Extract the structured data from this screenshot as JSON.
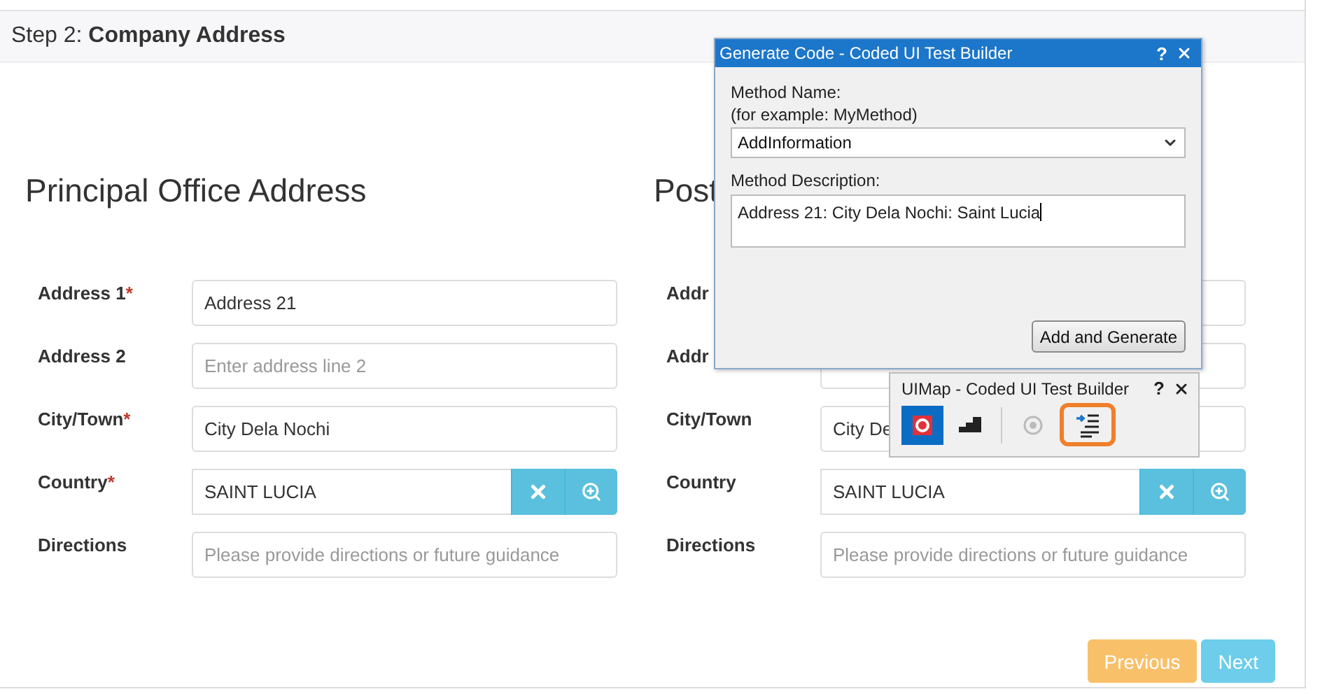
{
  "header": {
    "step": "Step 2:",
    "title": "Company Address"
  },
  "sections": [
    {
      "heading": "Principal Office Address",
      "fields": [
        {
          "label": "Address 1",
          "required_mark": "*",
          "value": "Address 21"
        },
        {
          "label": "Address 2",
          "placeholder": "Enter address line 2"
        },
        {
          "label": "City/Town",
          "required_mark": "*",
          "value": "City Dela Nochi"
        },
        {
          "label": "Country",
          "required_mark": "*",
          "value": "SAINT LUCIA",
          "kind": "lookup"
        },
        {
          "label": "Directions",
          "placeholder": "Please provide directions or future guidance"
        }
      ]
    },
    {
      "heading": "Post",
      "fields": [
        {
          "label": "Addr"
        },
        {
          "label": "Addr"
        },
        {
          "label": "City/Town",
          "value": "City De"
        },
        {
          "label": "Country",
          "value": "SAINT LUCIA",
          "kind": "lookup"
        },
        {
          "label": "Directions",
          "placeholder": "Please provide directions or future guidance"
        }
      ]
    }
  ],
  "buttons": [
    {
      "label": "Previous",
      "kind": "warning"
    },
    {
      "label": "Next",
      "kind": "info"
    }
  ],
  "dialog": {
    "title": "Generate Code - Coded UI Test Builder",
    "help": "?",
    "method_name_label": "Method Name:",
    "method_name_hint": "(for example: MyMethod)",
    "method_name": "AddInformation",
    "description_label": "Method Description:",
    "description": "Address 21: City Dela Nochi: Saint Lucia",
    "button": "Add and Generate"
  },
  "uimap": {
    "title": "UIMap - Coded UI Test Builder",
    "help": "?",
    "tools": [
      {
        "kind": "record",
        "selected": true,
        "disabled": false,
        "highlighted": false
      },
      {
        "kind": "steps",
        "selected": false,
        "disabled": false,
        "highlighted": false
      },
      {
        "kind": "target",
        "selected": false,
        "disabled": true,
        "highlighted": false
      },
      {
        "kind": "generate",
        "selected": false,
        "disabled": false,
        "highlighted": true
      }
    ]
  }
}
